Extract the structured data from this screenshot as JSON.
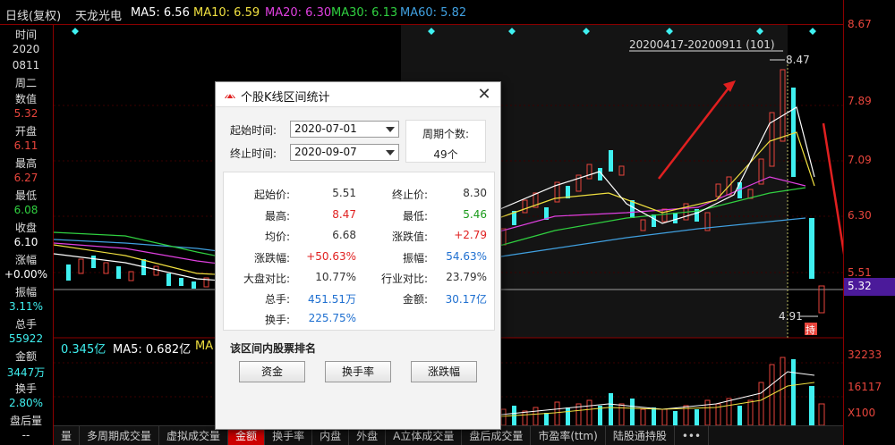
{
  "header": {
    "mode": "日线(复权)",
    "stock": "天龙光电",
    "ma5": "MA5: 6.56",
    "ma10": "MA10: 6.59",
    "ma20": "MA20: 6.30",
    "ma30": "MA30: 6.13",
    "ma60": "MA60: 5.82"
  },
  "left": {
    "time_label": "时间",
    "year": "2020",
    "date": "0811",
    "weekday": "周二",
    "count_label": "数值",
    "count_value": "5.32",
    "open_label": "开盘",
    "open_value": "6.11",
    "high_label": "最高",
    "high_value": "6.27",
    "low_label": "最低",
    "low_value": "6.08",
    "close_label": "收盘",
    "close_value": "6.10",
    "change_label": "涨幅",
    "change_value": "+0.00%",
    "amp_label": "振幅",
    "amp_value": "3.11%",
    "total_label": "总手",
    "total_value": "55922",
    "amount_label": "金额",
    "amount_value": "3447万",
    "turnover_label": "换手",
    "turnover_value": "2.80%",
    "after_label": "盘后量",
    "after_value": "--"
  },
  "right_axis": {
    "t1": "8.67",
    "t2": "7.89",
    "t3": "7.09",
    "t4": "6.30",
    "t5": "5.51",
    "current": "5.32",
    "v1": "32233",
    "v2": "16117",
    "v3": "X100"
  },
  "chart": {
    "range_label": "20200417-20200911 (101)",
    "high_marker": "8.47",
    "low_marker": "4.91",
    "tag": "持"
  },
  "volume": {
    "amount": "0.345亿",
    "ma5": "MA5: 0.682亿",
    "ma10": "MA"
  },
  "tabs": [
    {
      "label": "量",
      "active": false
    },
    {
      "label": "多周期成交量",
      "active": false
    },
    {
      "label": "虚拟成交量",
      "active": false
    },
    {
      "label": "金额",
      "active": true
    },
    {
      "label": "换手率",
      "active": false
    },
    {
      "label": "内盘",
      "active": false
    },
    {
      "label": "外盘",
      "active": false
    },
    {
      "label": "A立体成交量",
      "active": false
    },
    {
      "label": "盘后成交量",
      "active": false
    },
    {
      "label": "市盈率(ttm)",
      "active": false
    },
    {
      "label": "陆股通持股",
      "active": false
    },
    {
      "label": "•••",
      "active": false
    }
  ],
  "dialog": {
    "title": "个股K线区间统计",
    "start_label": "起始时间:",
    "start_value": "2020-07-01",
    "end_label": "终止时间:",
    "end_value": "2020-09-07",
    "period_label": "周期个数:",
    "period_value": "49个",
    "stats": {
      "start_price_k": "起始价:",
      "start_price_v": "5.51",
      "end_price_k": "终止价:",
      "end_price_v": "8.30",
      "high_k": "最高:",
      "high_v": "8.47",
      "low_k": "最低:",
      "low_v": "5.46",
      "avg_k": "均价:",
      "avg_v": "6.68",
      "chg_val_k": "涨跌值:",
      "chg_val_v": "+2.79",
      "chg_pct_k": "涨跌幅:",
      "chg_pct_v": "+50.63%",
      "amp_k": "振幅:",
      "amp_v": "54.63%",
      "market_k": "大盘对比:",
      "market_v": "10.77%",
      "industry_k": "行业对比:",
      "industry_v": "23.79%",
      "vol_k": "总手:",
      "vol_v": "451.51万",
      "amount_k": "金额:",
      "amount_v": "30.17亿",
      "turn_k": "换手:",
      "turn_v": "225.75%"
    },
    "rank_title": "该区间内股票排名",
    "btn_fund": "资金",
    "btn_turnover": "换手率",
    "btn_change": "涨跌幅"
  },
  "colors": {
    "up": "#e8453c",
    "down": "#3ff0f0",
    "ma5": "#ffffff",
    "ma10": "#f0e040",
    "ma20": "#e040e0",
    "ma30": "#30d040",
    "ma60": "#40a0e0"
  }
}
